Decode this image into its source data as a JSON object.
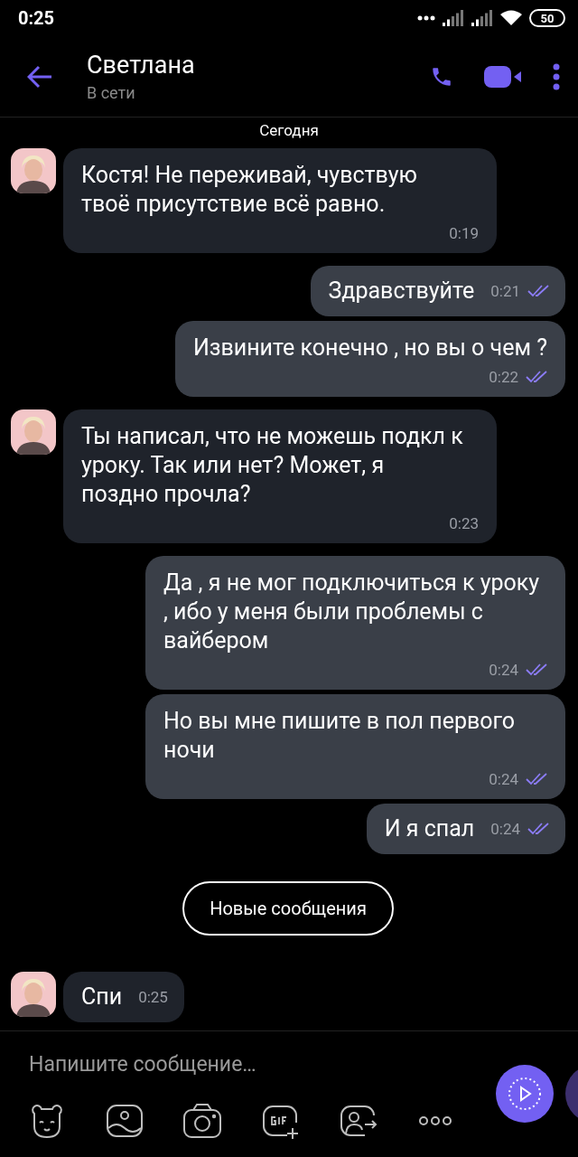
{
  "status_bar": {
    "time": "0:25",
    "battery": "50"
  },
  "header": {
    "title": "Светлана",
    "subtitle": "В сети"
  },
  "date_label": "Сегодня",
  "messages": [
    {
      "kind": "in",
      "text": "Костя! Не переживай, чувствую твоё присутствие всё равно.",
      "time": "0:19",
      "compact": false
    },
    {
      "kind": "out",
      "text": "Здравствуйте",
      "time": "0:21",
      "compact": true,
      "read": true
    },
    {
      "kind": "out",
      "text": "Извините конечно , но вы о чем ?",
      "time": "0:22",
      "compact": false,
      "read": true
    },
    {
      "kind": "in",
      "text": "Ты написал, что не можешь подкл к уроку. Так или нет? Может, я поздно прочла?",
      "time": "0:23",
      "compact": false
    },
    {
      "kind": "out",
      "text": "Да , я не мог подключиться к уроку , ибо у меня были проблемы с вайбером",
      "time": "0:24",
      "compact": false,
      "read": true
    },
    {
      "kind": "out",
      "text": "Но вы мне пишите в пол первого ночи",
      "time": "0:24",
      "compact": false,
      "read": true
    },
    {
      "kind": "out",
      "text": "И я спал",
      "time": "0:24",
      "compact": true,
      "read": true
    },
    {
      "kind": "divider",
      "text": "Новые сообщения"
    },
    {
      "kind": "in",
      "text": "Спи",
      "time": "0:25",
      "compact": true
    }
  ],
  "composer": {
    "placeholder": "Напишите сообщение…"
  }
}
